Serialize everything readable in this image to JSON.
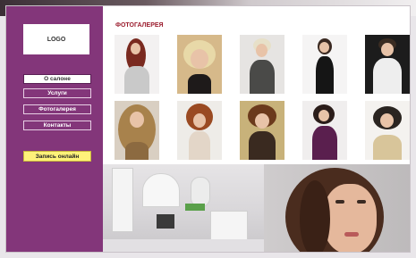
{
  "logo": "LOGO",
  "nav": [
    {
      "label": "О салоне"
    },
    {
      "label": "Услуги"
    },
    {
      "label": "Фотогалерея"
    },
    {
      "label": "Контакты"
    }
  ],
  "book_label": "Запись онлайн",
  "gallery": {
    "title": "ФОТОГАЛЕРЕЯ",
    "photos": [
      {
        "name": "photo-1-red-hair-woman"
      },
      {
        "name": "photo-2-blonde-bob-woman"
      },
      {
        "name": "photo-3-platinum-short-hair"
      },
      {
        "name": "photo-4-black-dress-pose"
      },
      {
        "name": "photo-5-man-suspenders"
      },
      {
        "name": "photo-6-long-wavy-blonde"
      },
      {
        "name": "photo-7-curly-updo"
      },
      {
        "name": "photo-8-auburn-bob"
      },
      {
        "name": "photo-9-purple-dress"
      },
      {
        "name": "photo-10-dark-bob-gold"
      }
    ]
  },
  "colors": {
    "sidebar": "#83367a",
    "title": "#9b1d2e",
    "book_button": "#fff27a"
  }
}
